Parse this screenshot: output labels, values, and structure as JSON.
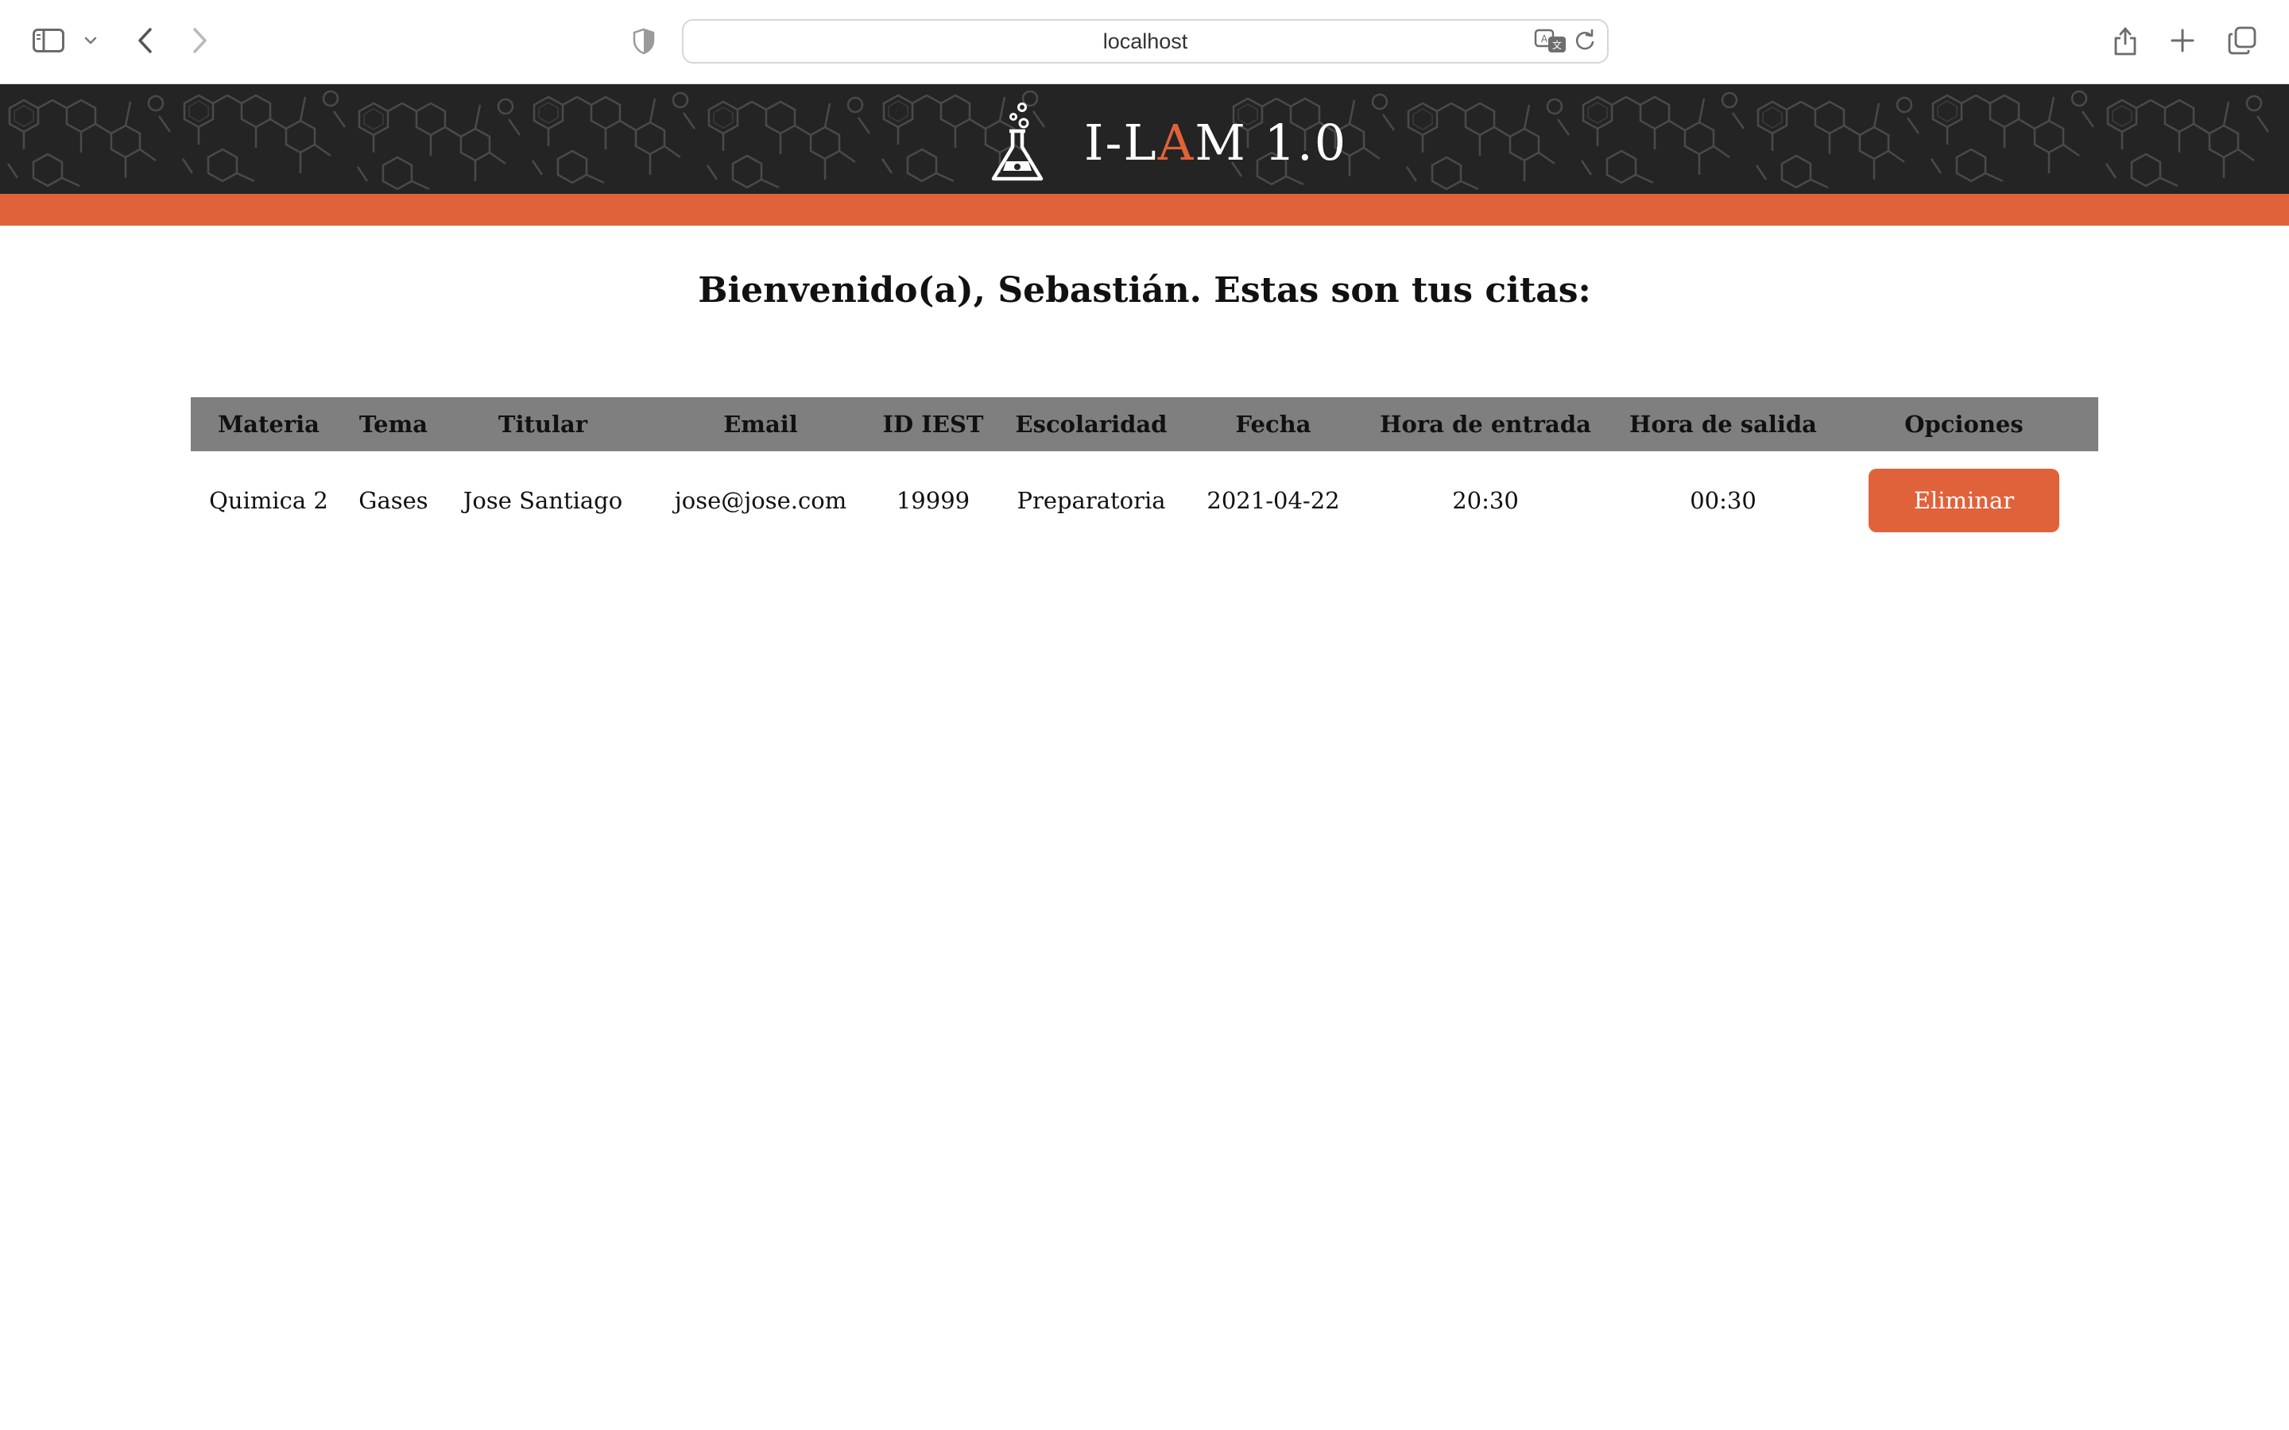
{
  "browser": {
    "url": "localhost",
    "icons": {
      "sidebar": "sidebar-icon",
      "sidebar_chevron": "chevron-down-icon",
      "back": "chevron-left-icon",
      "forward": "chevron-right-icon",
      "privacy": "shield-icon",
      "translate": "translate-icon",
      "reload": "reload-icon",
      "share": "share-icon",
      "new_tab": "plus-icon",
      "tabs": "tabs-overview-icon"
    }
  },
  "header": {
    "logo_icon": "flask-icon",
    "brand_prefix": "I-L",
    "brand_accent": "A",
    "brand_suffix": "M 1.0",
    "colors": {
      "background": "#242424",
      "accent": "#e0623a"
    }
  },
  "main": {
    "welcome": "Bienvenido(a), Sebastián. Estas son tus citas:",
    "table": {
      "columns": [
        "Materia",
        "Tema",
        "Titular",
        "Email",
        "ID IEST",
        "Escolaridad",
        "Fecha",
        "Hora de entrada",
        "Hora de salida",
        "Opciones"
      ],
      "rows": [
        {
          "materia": "Quimica 2",
          "tema": "Gases",
          "titular": "Jose Santiago",
          "email": "jose@jose.com",
          "id_iest": "19999",
          "escolaridad": "Preparatoria",
          "fecha": "2021-04-22",
          "hora_entrada": "20:30",
          "hora_salida": "00:30",
          "action_label": "Eliminar"
        }
      ]
    },
    "colors": {
      "header_bg": "#7f7f7f",
      "button": "#e0623a"
    }
  }
}
